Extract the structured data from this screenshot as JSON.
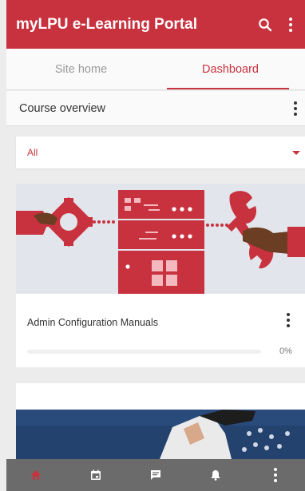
{
  "appbar": {
    "title": "myLPU e-Learning Portal",
    "search_icon": "search-icon",
    "more_icon": "more-vert-icon"
  },
  "tabs": [
    {
      "label": "Site home",
      "active": false
    },
    {
      "label": "Dashboard",
      "active": true
    }
  ],
  "overview": {
    "title": "Course overview",
    "menu_icon": "more-vert-icon"
  },
  "filter": {
    "selected": "All",
    "icon": "caret-down-icon"
  },
  "courses": [
    {
      "name": "Admin Configuration Manuals",
      "progress_percent": 0,
      "progress_label": "0%",
      "menu_icon": "more-vert-icon"
    }
  ],
  "bottom_nav": [
    {
      "icon": "home-icon",
      "active": true
    },
    {
      "icon": "calendar-icon",
      "active": false
    },
    {
      "icon": "messages-icon",
      "active": false
    },
    {
      "icon": "notifications-bell-icon",
      "active": false
    },
    {
      "icon": "more-vert-icon",
      "active": false
    }
  ],
  "colors": {
    "primary": "#c8323e",
    "bottom_nav_bg": "#6b6b6b",
    "page_bg": "#ececec"
  }
}
